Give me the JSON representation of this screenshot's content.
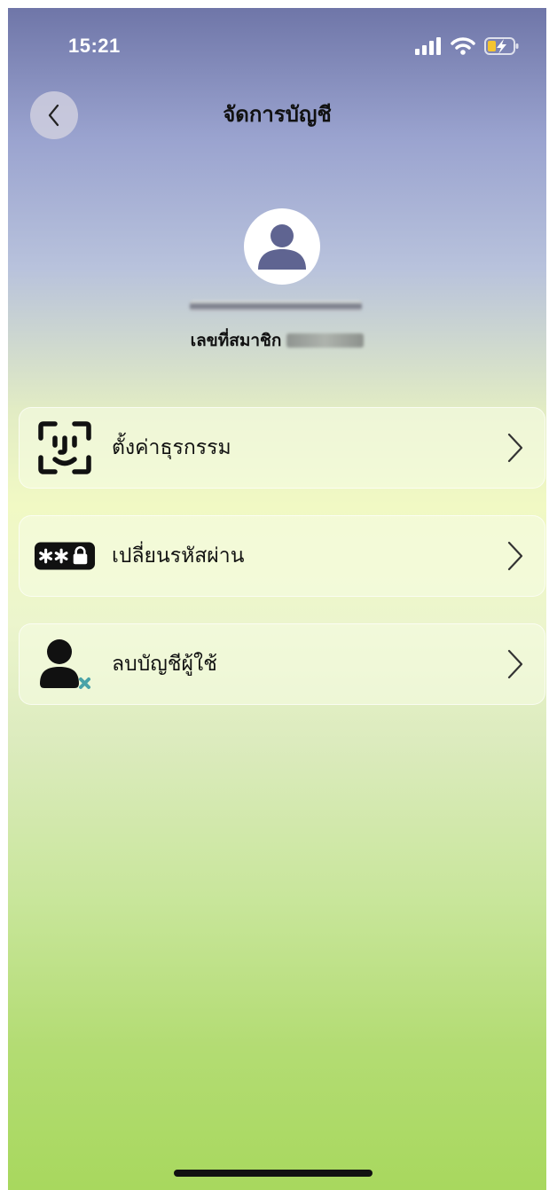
{
  "status_bar": {
    "time": "15:21",
    "icons": [
      "signal-icon",
      "wifi-icon",
      "battery-charging-icon"
    ],
    "battery_color": "#f4c430"
  },
  "header": {
    "title": "จัดการบัญชี",
    "back_icon": "chevron-left-icon"
  },
  "profile": {
    "avatar_icon": "person-icon",
    "member_label": "เลขที่สมาชิก"
  },
  "menu": {
    "items": [
      {
        "label": "ตั้งค่าธุรกรรม",
        "icon": "face-id-icon"
      },
      {
        "label": "เปลี่ยนรหัสผ่าน",
        "icon": "password-lock-icon"
      },
      {
        "label": "ลบบัญชีผู้ใช้",
        "icon": "delete-user-icon"
      }
    ],
    "chevron_icon": "chevron-right-icon"
  },
  "colors": {
    "accent_avatar": "#5f6491",
    "delete_badge": "#4aa3a8"
  }
}
